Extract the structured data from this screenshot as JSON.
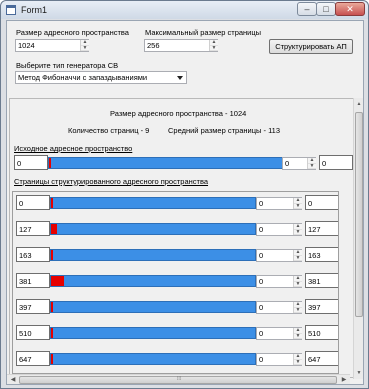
{
  "window": {
    "title": "Form1"
  },
  "top": {
    "addr_space_label": "Размер адресного пространства",
    "addr_space_value": "1024",
    "max_page_label": "Максимальный размер страницы",
    "max_page_value": "256",
    "structure_button": "Структурировать АП",
    "generator_label": "Выберите тип генератора СВ",
    "generator_value": "Метод Фибоначчи с запаздываниями"
  },
  "info": {
    "addr_space_size": "Размер адресного пространства -  1024",
    "page_count": "Количество страниц -  9",
    "avg_page_size": "Средний размер страницы -  113"
  },
  "source": {
    "title": "Исходное адресное пространство",
    "left": "0",
    "spin": "0",
    "right": "0",
    "red_fraction": 0.002
  },
  "pages": {
    "title": "Страницы структурированного адресного пространства",
    "rows": [
      {
        "left": "0",
        "spin": "0",
        "right": "0",
        "red_fraction": 0.006
      },
      {
        "left": "127",
        "spin": "0",
        "right": "127",
        "red_fraction": 0.03
      },
      {
        "left": "163",
        "spin": "0",
        "right": "163",
        "red_fraction": 0.006
      },
      {
        "left": "381",
        "spin": "0",
        "right": "381",
        "red_fraction": 0.065
      },
      {
        "left": "397",
        "spin": "0",
        "right": "397",
        "red_fraction": 0.006
      },
      {
        "left": "510",
        "spin": "0",
        "right": "510",
        "red_fraction": 0.006
      },
      {
        "left": "647",
        "spin": "0",
        "right": "647",
        "red_fraction": 0.006
      }
    ]
  },
  "colors": {
    "bar": "#3c8fe6",
    "marker": "#e60000"
  }
}
